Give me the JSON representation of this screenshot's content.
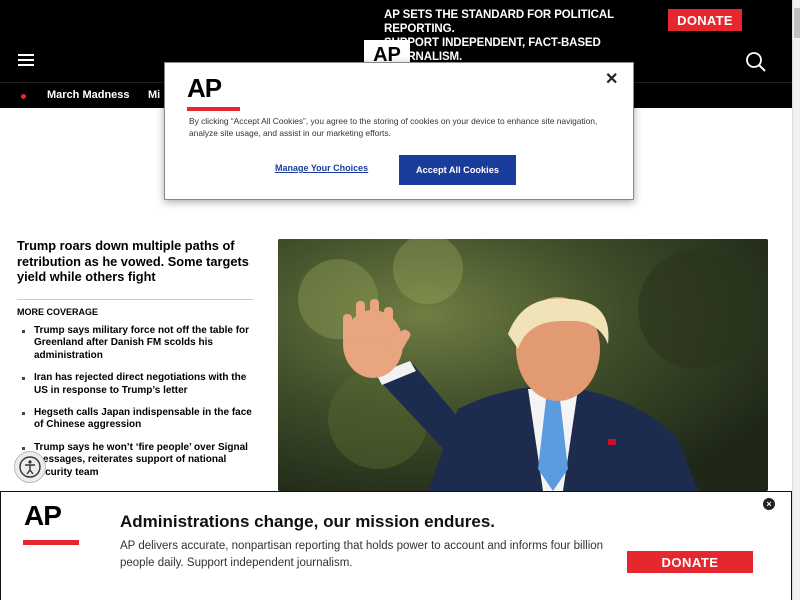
{
  "promo": {
    "line1": "AP SETS THE STANDARD FOR POLITICAL REPORTING.",
    "line2": "SUPPORT INDEPENDENT, FACT-BASED JOURNALISM.",
    "donate_label": "DONATE"
  },
  "header": {
    "logo": "AP",
    "menu_icon": "hamburger-menu-icon",
    "search_icon": "search-icon"
  },
  "nav": {
    "items": [
      {
        "label": "March Madness"
      },
      {
        "label": "Mi"
      }
    ]
  },
  "cookie": {
    "logo": "AP",
    "text": "By clicking “Accept All Cookies”, you agree to the storing of cookies on your device to enhance site navigation, analyze site usage, and assist in our marketing efforts.",
    "manage_label": "Manage Your Choices",
    "accept_label": "Accept All Cookies",
    "close_label": "✕"
  },
  "article": {
    "headline": "Trump roars down multiple paths of retribution as he vowed. Some targets yield while others fight",
    "more_coverage_label": "MORE COVERAGE",
    "related": [
      "Trump says military force not off the table for Greenland after Danish FM scolds his administration",
      "Iran has rejected direct negotiations with the US in response to Trump’s letter",
      "Hegseth calls Japan indispensable in the face of Chinese aggression",
      "Trump says he won’t ‘fire people’ over Signal messages, reiterates support of national security team"
    ]
  },
  "bottom_banner": {
    "logo": "AP",
    "title": "Administrations change, our mission endures.",
    "text": "AP delivers accurate, nonpartisan reporting that holds power to account and informs four billion people daily. Support independent journalism.",
    "donate_label": "DONATE",
    "close_label": "×"
  },
  "colors": {
    "brand_red": "#e6282e",
    "accept_blue": "#1a3d9b",
    "header_black": "#000000"
  }
}
